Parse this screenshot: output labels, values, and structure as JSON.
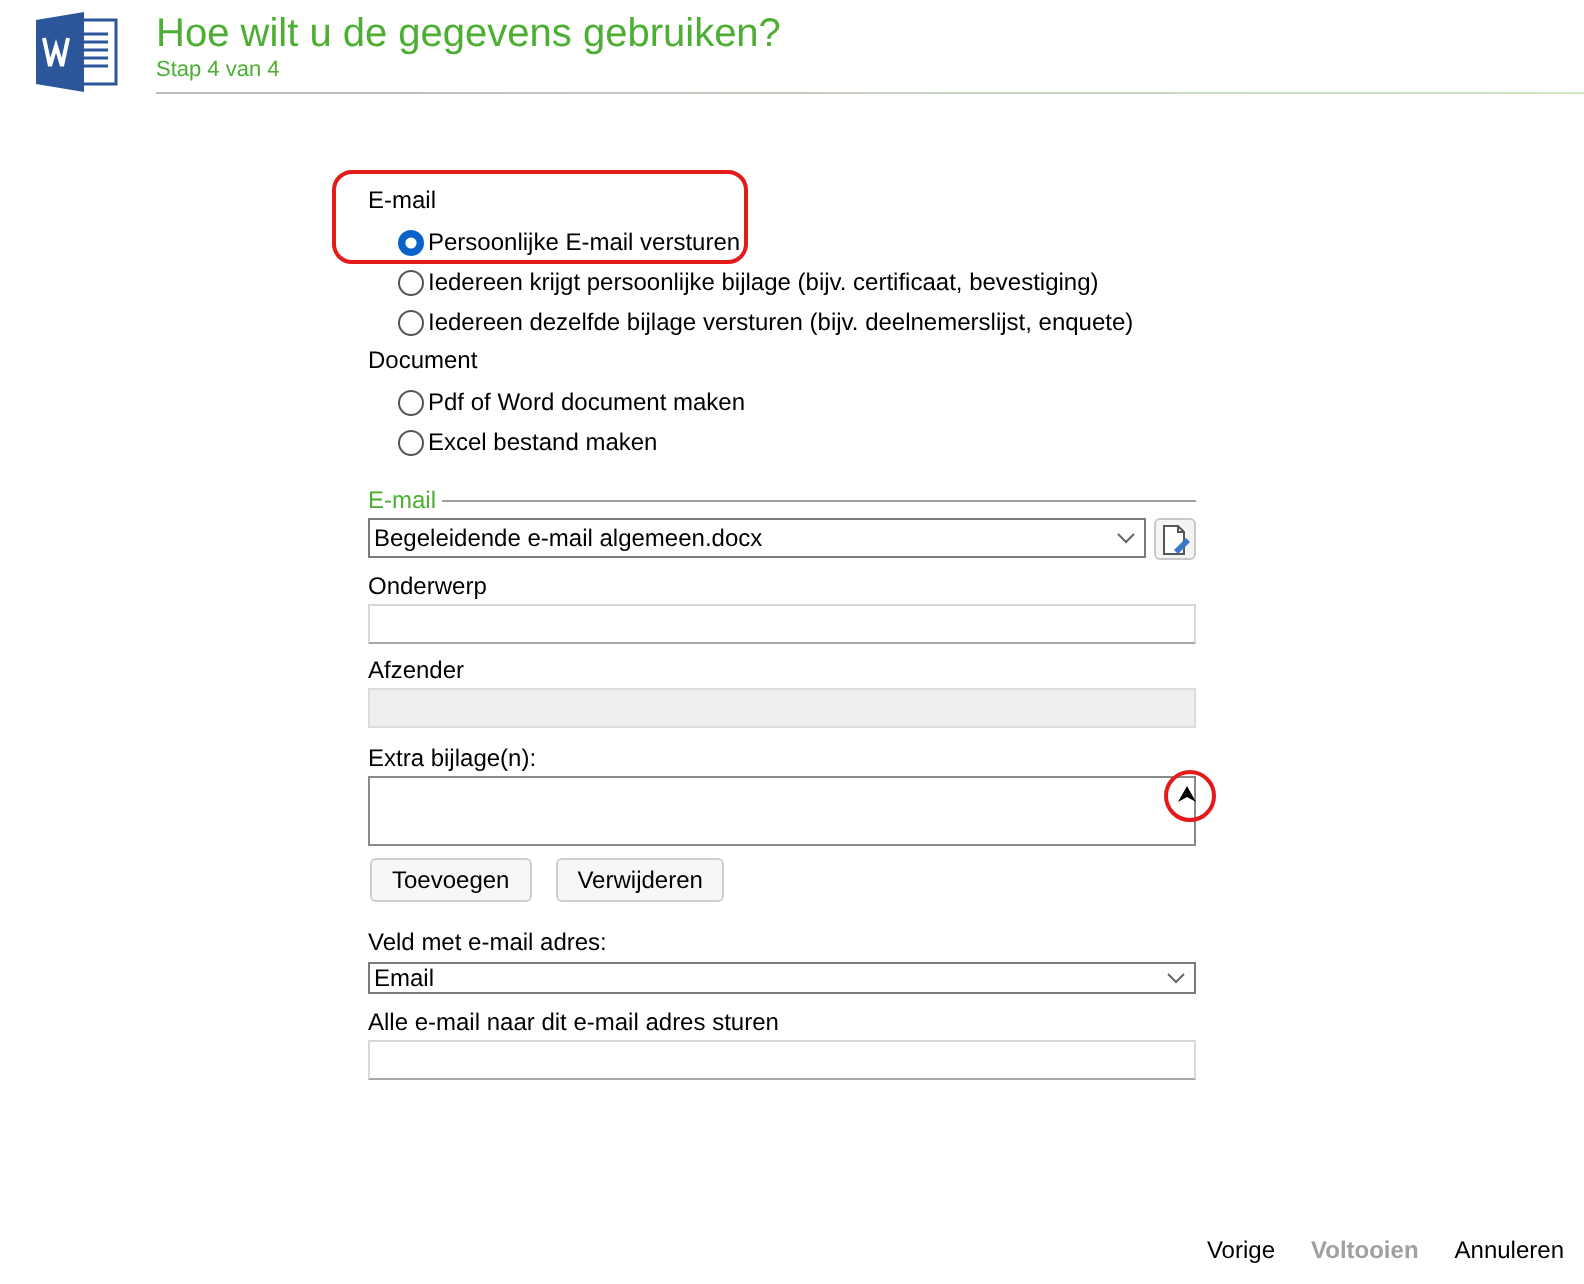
{
  "header": {
    "title": "Hoe wilt u de gegevens gebruiken?",
    "step": "Stap 4 van 4"
  },
  "options": [
    {
      "kind": "group-label",
      "label": "E-mail"
    },
    {
      "kind": "radio",
      "label": "Persoonlijke E-mail versturen",
      "selected": true
    },
    {
      "kind": "radio",
      "label": "Iedereen krijgt persoonlijke bijlage (bijv. certificaat, bevestiging)",
      "selected": false
    },
    {
      "kind": "radio",
      "label": "Iedereen dezelfde bijlage versturen (bijv. deelnemerslijst, enquete)",
      "selected": false
    },
    {
      "kind": "group-label",
      "label": "Document"
    },
    {
      "kind": "radio",
      "label": "Pdf of Word document maken",
      "selected": false
    },
    {
      "kind": "radio",
      "label": "Excel bestand maken",
      "selected": false
    }
  ],
  "email_section": {
    "heading": "E-mail",
    "template": {
      "value": "Begeleidende e-mail algemeen.docx"
    },
    "subject": {
      "label": "Onderwerp",
      "disabled": false
    },
    "sender": {
      "label": "Afzender",
      "disabled": true
    },
    "attachments": {
      "label": "Extra bijlage(n):"
    },
    "buttons": [
      "Toevoegen",
      "Verwijderen"
    ],
    "address_field": {
      "label": "Veld met e-mail adres:",
      "value": "Email"
    },
    "redirect": {
      "label": "Alle e-mail naar dit e-mail adres sturen",
      "disabled": false
    }
  },
  "footer": [
    {
      "label": "Vorige",
      "disabled": false
    },
    {
      "label": "Voltooien",
      "disabled": true
    },
    {
      "label": "Annuleren",
      "disabled": false
    }
  ]
}
